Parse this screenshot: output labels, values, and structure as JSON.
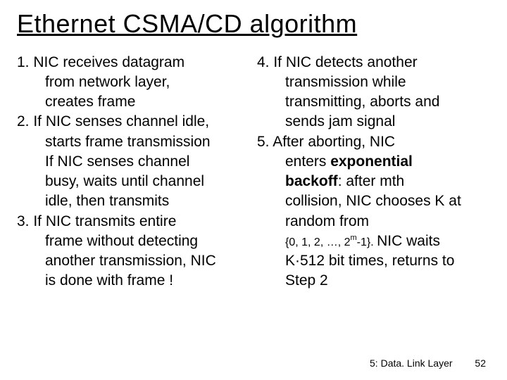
{
  "slide": {
    "title": "Ethernet CSMA/CD algorithm",
    "left": {
      "p1a": "1. NIC receives datagram",
      "p1b": "from network layer,",
      "p1c": "creates frame",
      "p2a": "2. If NIC senses channel idle,",
      "p2b": "starts frame transmission",
      "p2c": "If NIC senses channel",
      "p2d": "busy, waits until channel",
      "p2e": "idle, then transmits",
      "p3a": "3. If NIC transmits entire",
      "p3b": "frame without detecting",
      "p3c": "another transmission, NIC",
      "p3d": "is done with frame !"
    },
    "right": {
      "p4a": "4. If NIC detects another",
      "p4b": "transmission while",
      "p4c": "transmitting,  aborts and",
      "p4d": "sends jam signal",
      "p5a": "5. After aborting, NIC",
      "p5b_pre": "enters ",
      "p5b_bold": "exponential",
      "p5c_bold": "backoff",
      "p5c_post": ": after mth",
      "p5d": "collision, NIC chooses K at",
      "p5e": "random from",
      "p5f_set": "{0, 1, 2, …, 2",
      "p5f_sup": "m",
      "p5f_set2": "-1}. ",
      "p5f_post": "NIC waits",
      "p5g": "K·512 bit times, returns to",
      "p5h": "Step 2"
    },
    "footer": {
      "chapter": "5: Data. Link Layer",
      "page": "52"
    }
  }
}
